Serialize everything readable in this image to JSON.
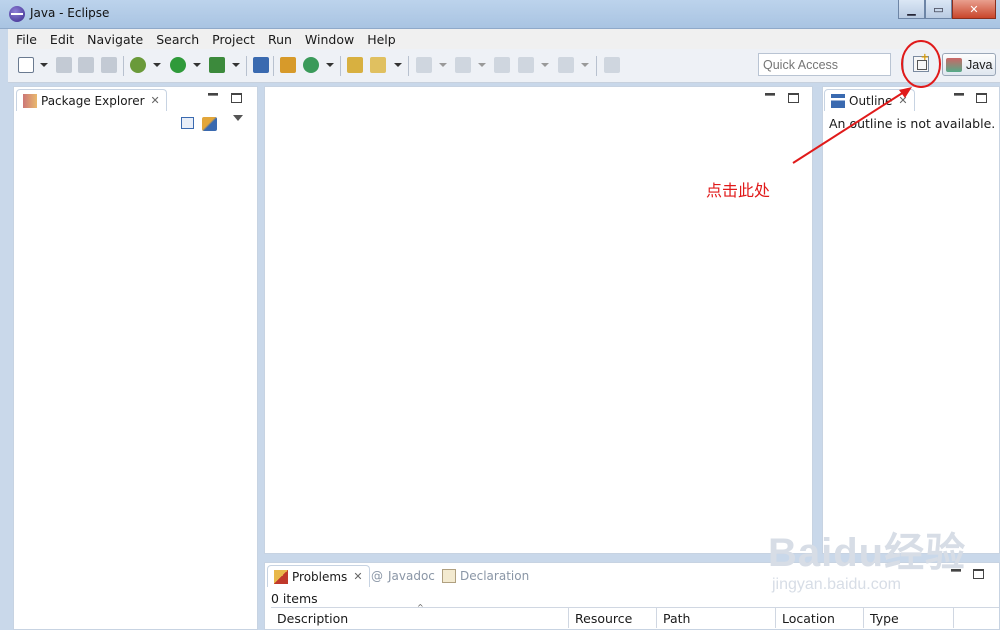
{
  "window": {
    "title": "Java - Eclipse",
    "minimize": "▁",
    "maximize": "▭",
    "close": "✕"
  },
  "menu": [
    "File",
    "Edit",
    "Navigate",
    "Search",
    "Project",
    "Run",
    "Window",
    "Help"
  ],
  "toolbar": {
    "quick_access_placeholder": "Quick Access",
    "perspective_label": "Java"
  },
  "package_explorer": {
    "tab_label": "Package Explorer"
  },
  "outline": {
    "tab_label": "Outline",
    "message": "An outline is not available."
  },
  "bottom": {
    "tabs": [
      "Problems",
      "Javadoc",
      "Declaration"
    ],
    "items_count": "0 items",
    "columns": [
      "Description",
      "Resource",
      "Path",
      "Location",
      "Type"
    ]
  },
  "annotation": {
    "text": "点击此处",
    "color": "#e01a1a"
  },
  "watermark": {
    "logo": "Baidu经验",
    "url": "jingyan.baidu.com"
  },
  "icons": [
    "eclipse-icon",
    "new-icon",
    "save-icon",
    "save-all-icon",
    "print-icon",
    "debug-icon",
    "run-icon",
    "external-tools-icon",
    "skip-breakpoints-icon",
    "new-java-package-icon",
    "new-java-class-icon",
    "open-type-icon",
    "search-icon",
    "next-annotation-icon",
    "back-icon",
    "forward-icon",
    "pin-icon",
    "open-perspective-icon"
  ]
}
